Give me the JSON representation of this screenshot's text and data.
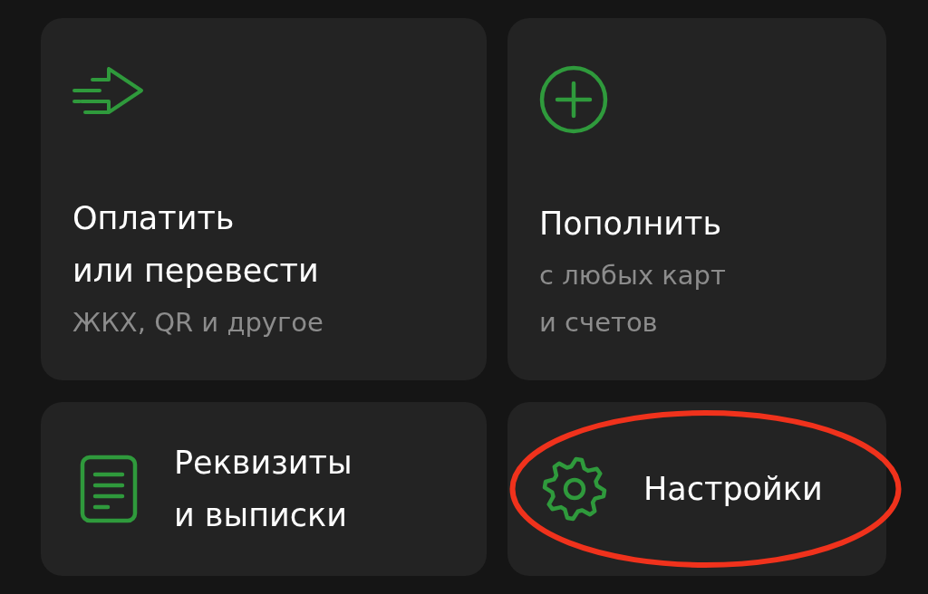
{
  "cards": [
    {
      "kind": "large",
      "title": [
        "Оплатить",
        "или перевести"
      ],
      "subtitle": [
        "ЖКХ, QR и другое"
      ],
      "highlighted": false
    },
    {
      "kind": "large",
      "title": [
        "Пополнить"
      ],
      "subtitle": [
        "с любых карт",
        "и счетов"
      ],
      "highlighted": false
    },
    {
      "kind": "small",
      "title": [
        "Реквизиты",
        "и выписки"
      ],
      "highlighted": false
    },
    {
      "kind": "small",
      "title": [
        "Настройки"
      ],
      "highlighted": true
    }
  ]
}
